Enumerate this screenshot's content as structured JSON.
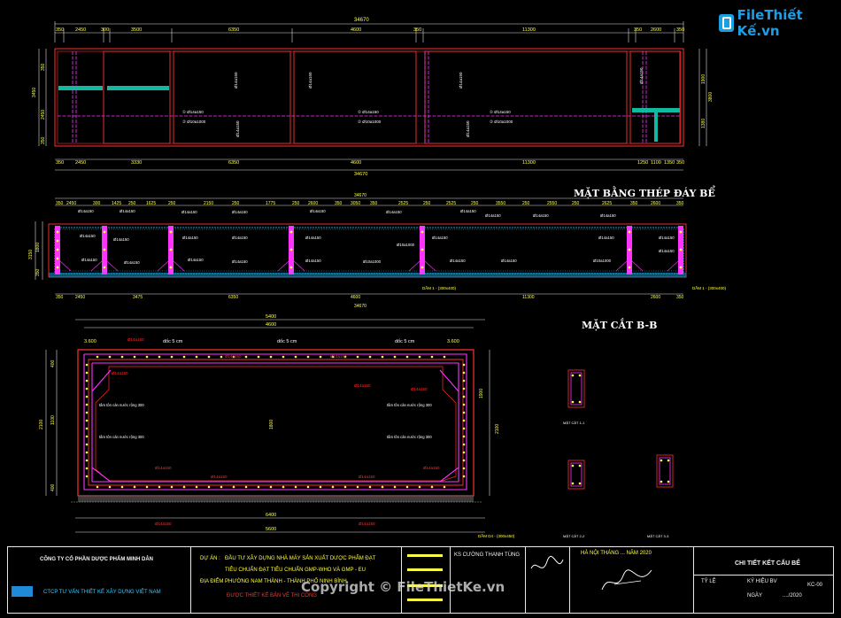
{
  "logo": {
    "text": "FileThiết Kế.vn",
    "icon": "file-icon"
  },
  "watermark": "Copyright © FileThietKe.vn",
  "views": {
    "plan_title": "MẶT BẰNG THÉP ĐÁY BỂ",
    "section_title": "MẶT CẮT B-B"
  },
  "dims": {
    "top_total": "34670",
    "top_row": [
      "350",
      "2450",
      "300",
      "3500",
      "6350",
      "4600",
      "350",
      "11300",
      "350",
      "2600",
      "350"
    ],
    "bottom_row_1": [
      "350",
      "2450",
      "3330",
      "6350",
      "4600",
      "11300",
      "1250",
      "1100",
      "1350",
      "350"
    ],
    "mid_row": [
      "350",
      "2450",
      "300",
      "1425",
      "250",
      "1625",
      "250",
      "2150",
      "250",
      "1775",
      "250",
      "2600",
      "250",
      "3050",
      "350",
      "2525",
      "250",
      "3550",
      "250",
      "2550",
      "250",
      "2625",
      "350",
      "2600",
      "350"
    ],
    "mid_bottom_row": [
      "2450",
      "3475",
      "6350",
      "4600",
      "11300",
      "2600"
    ],
    "section_top": [
      "5400",
      "4600"
    ],
    "section_bottom": [
      "6400",
      "5600"
    ],
    "left_dims_1": [
      "350",
      "2450",
      "350"
    ],
    "right_dims_1": [
      "1900",
      "1380",
      "350"
    ],
    "left_total": "3450",
    "right_total": "3800",
    "left_section": [
      "400",
      "1100",
      "2100",
      "400"
    ],
    "right_section": [
      "1900",
      "3400",
      "2100"
    ],
    "section_inner": "1800"
  },
  "labels": {
    "slope": [
      "dốc 5 cm",
      "dốc 5 cm",
      "dốc 5 cm"
    ],
    "levels": [
      "3.600",
      "3.600"
    ],
    "waterstop": [
      "tấm tôn cản nước rộng 300",
      "tấm tôn cản nước rộng 300",
      "tấm tôn cản nước rộng 300",
      "tấm tôn cản nước rộng 300"
    ],
    "rebar": [
      "Ø14a150",
      "Ø14a150",
      "Ø14a150",
      "Ø14a150",
      "Ø14a150",
      "Ø14a150",
      "Ø10a1000",
      "Ø14a150",
      "Ø14a150",
      "Ø10a1000"
    ],
    "section_marks": [
      "DẦM 1 - (300x400)",
      "DẦM 1 - (300x400)",
      "DẦM D4 - (300x450)"
    ],
    "small_details": [
      "MẶT CẮT 1-1",
      "MẶT CẮT 2-2",
      "MẶT CẮT 3-3"
    ]
  },
  "title_block": {
    "company": "CÔNG TY CỔ PHẦN DƯỢC PHẨM MINH DÂN",
    "designer": "CTCP TƯ VẤN THIẾT KẾ XÂY DỰNG VIỆT NAM",
    "project_label": "DỰ ÁN :",
    "project": "ĐẦU TƯ XÂY DỰNG NHÀ MÁY SẢN XUẤT DƯỢC PHẨM ĐẠT",
    "project_2": "TIÊU CHUẨN ĐẠT TIÊU CHUẨN GMP-WHO VÀ GMP - EU",
    "location_label": "ĐỊA ĐIỂM :",
    "location": "PHƯỜNG NAM THÀNH - THÀNH PHỐ NINH BÌNH",
    "approval": "ĐƯỢC THIẾT KẾ BẢN VẼ THI CÔNG",
    "role_1": "KS CƯỜNG THANH TÙNG",
    "date": "HÀ NỘI THÁNG ... NĂM 2020",
    "drawing_title": "CHI TIẾT KẾT CẤU BỂ",
    "sheet_label": "TỶ LỆ",
    "sheet_no_label": "KÝ HIỆU BV",
    "sheet_no": "KC-00",
    "date_label": "NGÀY",
    "date_val": "..../2020"
  },
  "colors": {
    "frame": "#e8e8e8",
    "beam": "#ff3030",
    "rebar": "#ff33ff",
    "wall": "#22dd22",
    "teal": "#12b8a0",
    "cyan": "#33ccff",
    "dim": "#dddddd"
  }
}
